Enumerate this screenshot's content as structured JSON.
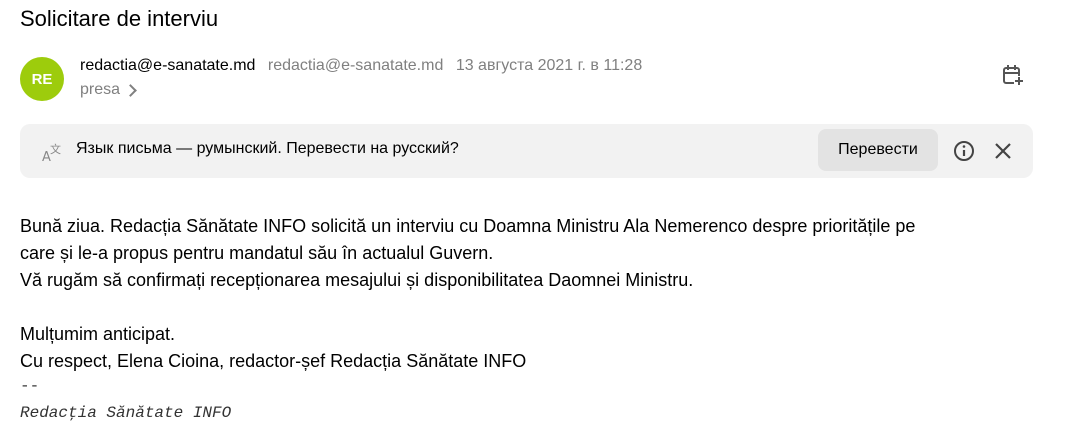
{
  "message": {
    "subject": "Solicitare de interviu",
    "avatar_initials": "RE",
    "avatar_color": "#9dcc0c",
    "from_name": "redactia@e-sanatate.md",
    "from_email": "redactia@e-sanatate.md",
    "date": "13 августа 2021 г. в 11:28",
    "folder": "presa"
  },
  "translate": {
    "text": "Язык письма — румынский. Перевести на русский?",
    "button_label": "Перевести"
  },
  "body": {
    "line1": "Bună ziua. Redacția Sănătate INFO solicită un interviu cu Doamna Ministru Ala Nemerenco despre prioritățile pe",
    "line2": "care și le-a propus pentru mandatul său în actualul Guvern.",
    "line3": "Vă rugăm să confirmați recepționarea mesajului și disponibilitatea Daomnei Ministru.",
    "line4": "Mulțumim anticipat.",
    "line5": "Cu respect, Elena Cioina, redactor-șef Redacția Sănătate INFO",
    "sig_dash": "--",
    "sig_name": "Redacţia Sănătate INFO"
  },
  "icons": {
    "calendar": "calendar-add-icon",
    "translate": "translate-icon",
    "info": "info-icon",
    "close": "close-icon"
  }
}
